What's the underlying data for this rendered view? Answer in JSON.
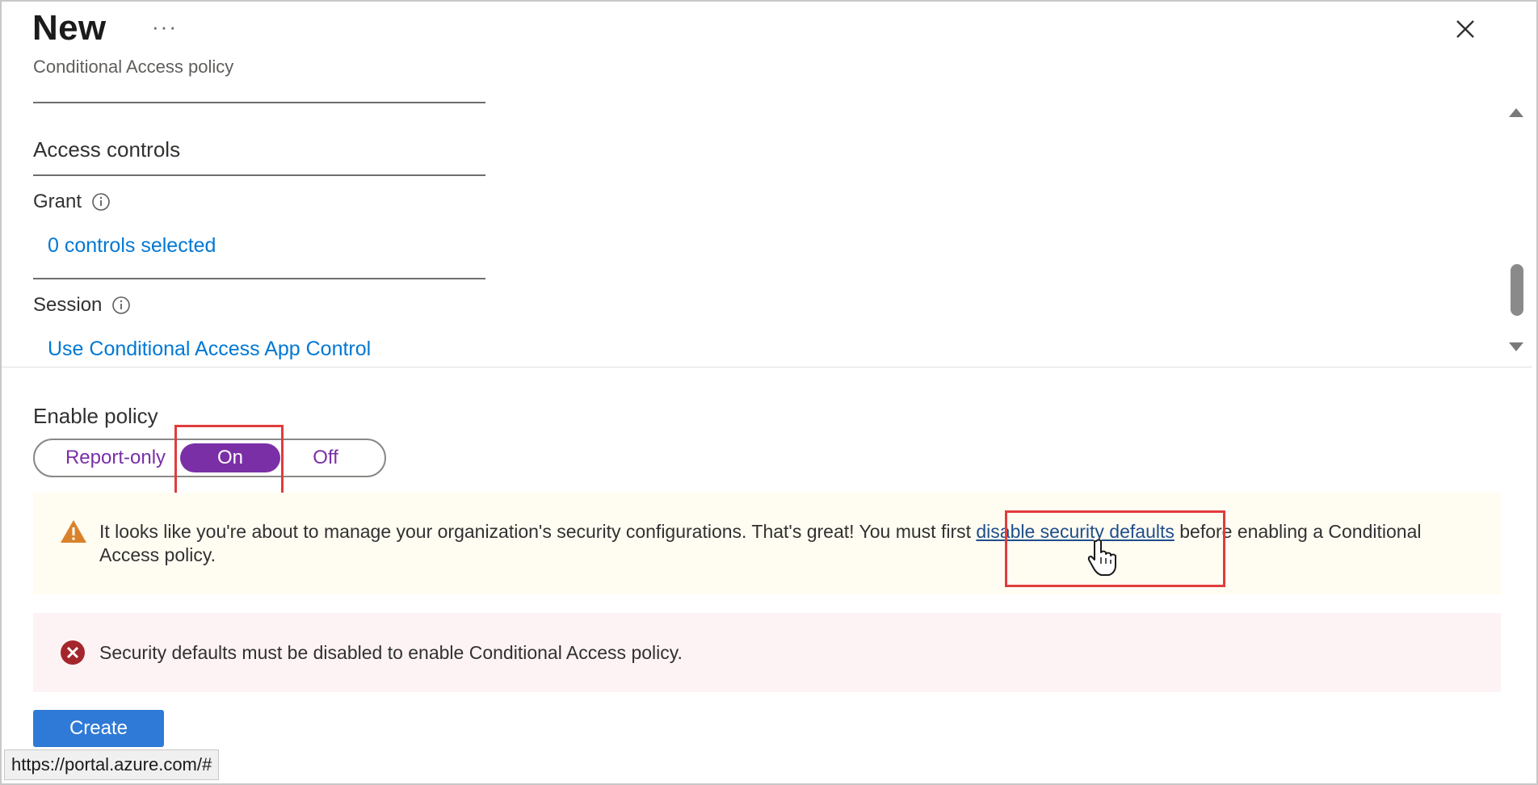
{
  "header": {
    "title": "New",
    "more_label": "···",
    "subtitle": "Conditional Access policy",
    "close_icon": "close-icon"
  },
  "access_controls": {
    "title": "Access controls",
    "grant": {
      "label": "Grant",
      "link": "0 controls selected",
      "icon": "info-icon"
    },
    "session": {
      "label": "Session",
      "link": "Use Conditional Access App Control",
      "icon": "info-icon"
    }
  },
  "enable_policy": {
    "label": "Enable policy",
    "options": [
      "Report-only",
      "On",
      "Off"
    ],
    "selected": "On",
    "accent_color": "#7b2fa6"
  },
  "warning": {
    "icon": "warning-icon",
    "text_before": "It looks like you're about to manage your organization's security configurations. That's great! You must first ",
    "link": "disable security defaults",
    "text_after": " before enabling a Conditional Access policy."
  },
  "error": {
    "icon": "error-icon",
    "text": "Security defaults must be disabled to enable Conditional Access policy."
  },
  "create_button": {
    "label": "Create",
    "color": "#2f7ad6"
  },
  "status_bar": {
    "url": "https://portal.azure.com/#"
  }
}
